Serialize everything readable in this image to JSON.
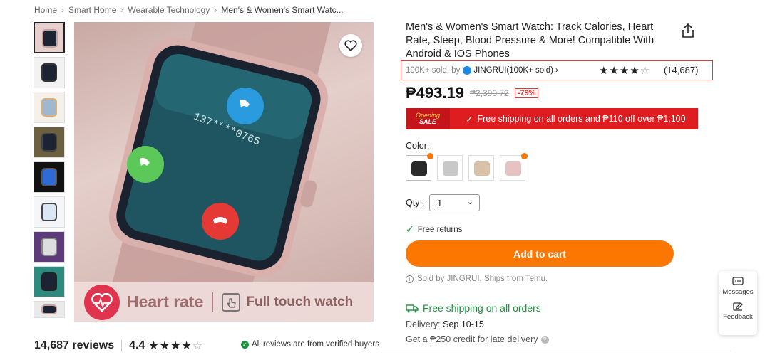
{
  "breadcrumb": [
    "Home",
    "Smart Home",
    "Wearable Technology",
    "Men's & Women's Smart Watc..."
  ],
  "breadcrumb_sep": "›",
  "gallery": {
    "thumb_count": 9,
    "banner_left": "Heart rate",
    "banner_right": "Full touch watch",
    "watch_call_number": "137****0765"
  },
  "reviews_bar": {
    "count_label": "14,687 reviews",
    "rating": "4.4",
    "stars": "★★★★",
    "verified_text": "All reviews are from verified buyers"
  },
  "product": {
    "title": "Men's & Women's Smart Watch: Track Calories, Heart Rate, Sleep, Blood Pressure & More! Compatible With Android & IOS Phones",
    "sold_text": "100K+ sold, by",
    "store_name": "JINGRUI(100K+ sold)",
    "store_chevron": "›",
    "rating_stars": "★★★★",
    "rating_count": "(14,687)",
    "price": "₱493.19",
    "original_price": "₱2,390.72",
    "discount": "-79%"
  },
  "promo": {
    "tag_line1": "Opening",
    "tag_line2": "SALE",
    "text": "Free shipping on all orders and ₱110 off over ₱1,100"
  },
  "color": {
    "label": "Color:",
    "swatches": [
      "black",
      "silver",
      "gold",
      "pink"
    ],
    "swatch_colors": [
      "#2a2a2a",
      "#c8c8c8",
      "#d8c1a6",
      "#e7c2c3"
    ]
  },
  "quantity": {
    "label": "Qty :",
    "value": "1"
  },
  "free_returns": "Free returns",
  "add_to_cart": "Add to cart",
  "sold_by": "Sold by JINGRUI. Ships from Temu.",
  "shipping": {
    "title": "Free shipping on all orders",
    "delivery_label": "Delivery:",
    "delivery_dates": "Sep 10-15",
    "credit": "Get a ₱250 credit for late delivery"
  },
  "side_panel": {
    "messages": "Messages",
    "feedback": "Feedback"
  },
  "colors": {
    "accent_orange": "#fb7701",
    "promo_red": "#dd1d20",
    "green": "#1d8f3e",
    "highlight_box": "#e53935"
  }
}
